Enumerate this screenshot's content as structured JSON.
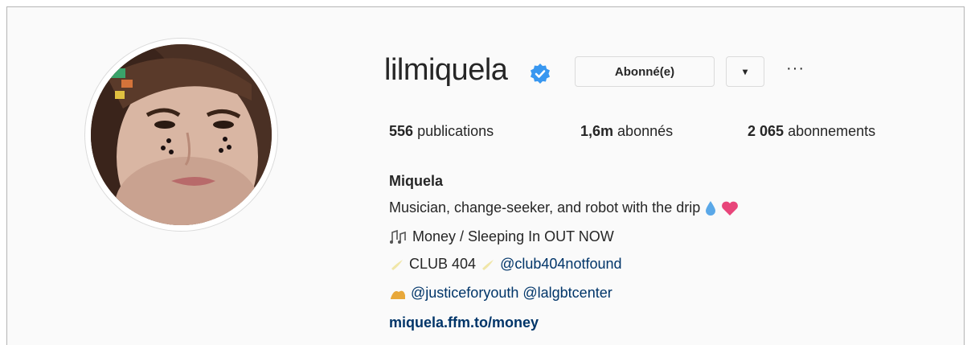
{
  "profile": {
    "username": "lilmiquela",
    "follow_button": "Abonné(e)",
    "dropdown_icon": "▾",
    "more_icon": "···",
    "stats": {
      "posts_count": "556",
      "posts_label": "publications",
      "followers_count": "1,6m",
      "followers_label": "abonnés",
      "following_count": "2 065",
      "following_label": "abonnements"
    },
    "bio": {
      "name": "Miquela",
      "line1": "Musician, change-seeker, and robot with the drip",
      "line2": "Money / Sleeping In OUT NOW",
      "line3_text": "CLUB 404",
      "line3_mention": "@club404notfound",
      "line4_mention1": "@justiceforyouth",
      "line4_mention2": "@lalgbtcenter",
      "link": "miquela.ffm.to/money"
    }
  },
  "colors": {
    "verified": "#3897f0",
    "link": "#003569",
    "text": "#262626",
    "border": "#dbdbdb"
  }
}
